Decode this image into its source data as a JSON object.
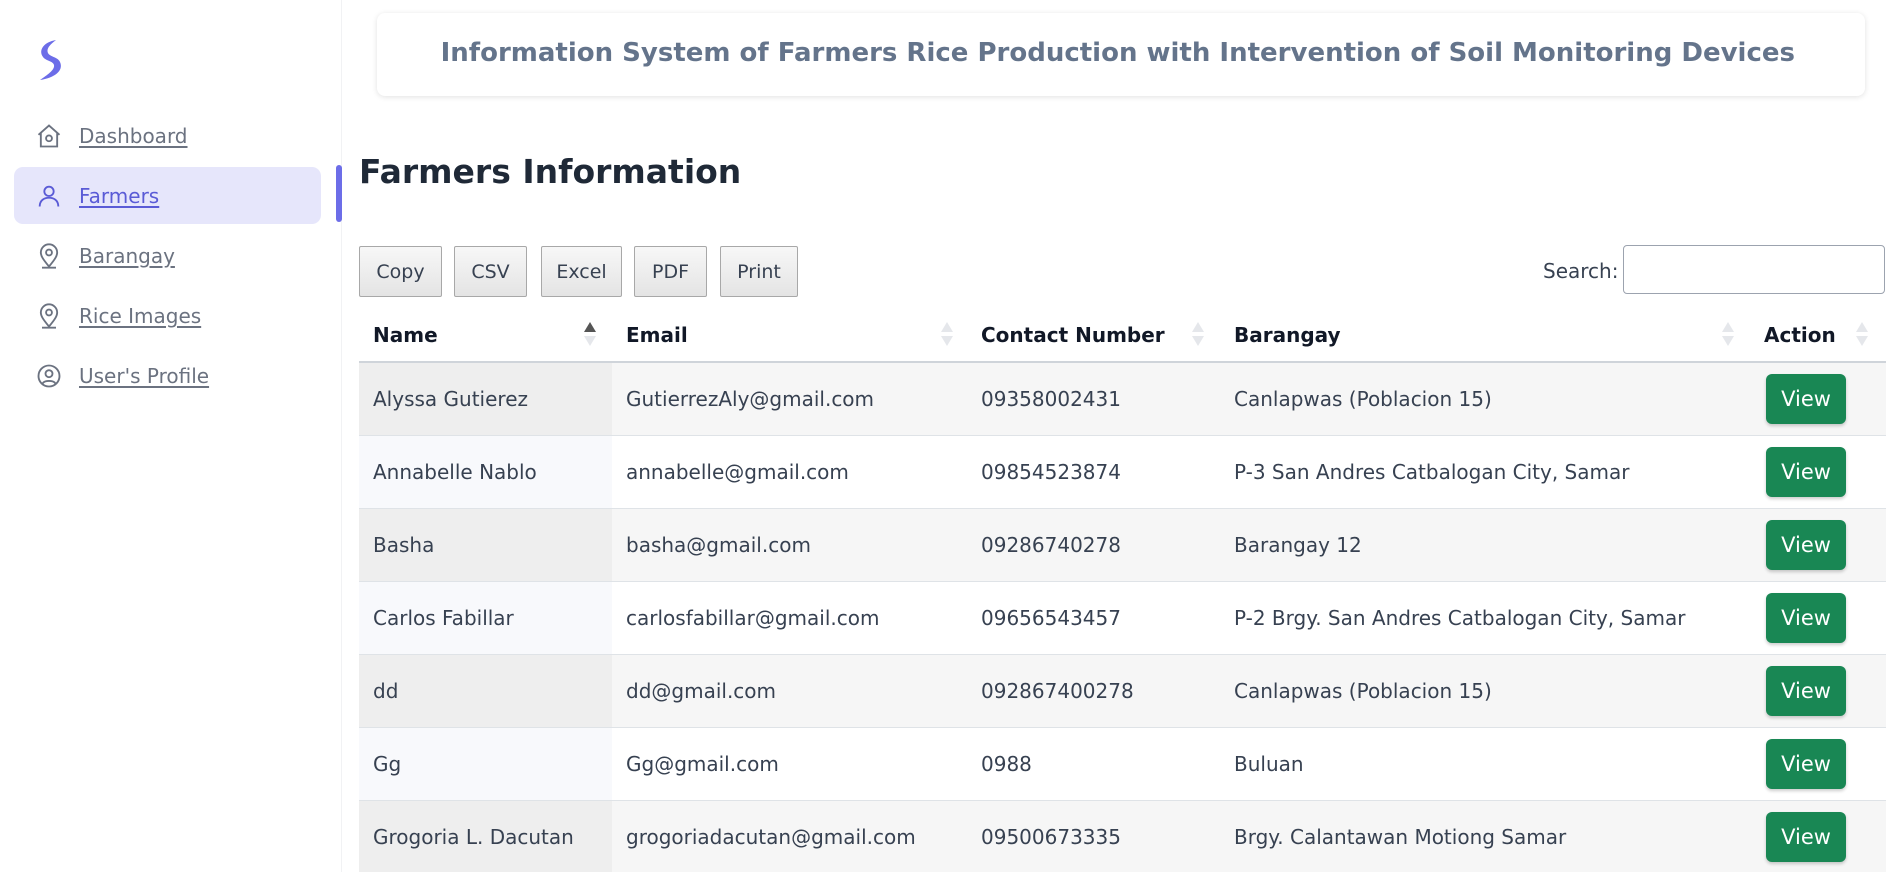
{
  "sidebar": {
    "items": [
      {
        "label": "Dashboard",
        "icon": "home-icon"
      },
      {
        "label": "Farmers",
        "icon": "user-icon",
        "active": true
      },
      {
        "label": "Barangay",
        "icon": "map-pin-icon"
      },
      {
        "label": "Rice Images",
        "icon": "map-pin-icon"
      },
      {
        "label": "User's Profile",
        "icon": "user-circle-icon"
      }
    ]
  },
  "header": {
    "title": "Information System of Farmers Rice Production with Intervention of Soil Monitoring Devices"
  },
  "page": {
    "title": "Farmers Information"
  },
  "toolbar": {
    "buttons": [
      "Copy",
      "CSV",
      "Excel",
      "PDF",
      "Print"
    ],
    "search_label": "Search:",
    "search_value": ""
  },
  "table": {
    "columns": [
      "Name",
      "Email",
      "Contact Number",
      "Barangay",
      "Action"
    ],
    "sorted_column": "Name",
    "sort_direction": "ascending",
    "rows": [
      {
        "name": "Alyssa Gutierez",
        "email": "GutierrezAly@gmail.com",
        "contact": "09358002431",
        "barangay": "Canlapwas (Poblacion 15)",
        "action": "View"
      },
      {
        "name": "Annabelle Nablo",
        "email": "annabelle@gmail.com",
        "contact": "09854523874",
        "barangay": "P-3 San Andres Catbalogan City, Samar",
        "action": "View"
      },
      {
        "name": "Basha",
        "email": "basha@gmail.com",
        "contact": "09286740278",
        "barangay": "Barangay 12",
        "action": "View"
      },
      {
        "name": "Carlos Fabillar",
        "email": "carlosfabillar@gmail.com",
        "contact": "09656543457",
        "barangay": "P-2 Brgy. San Andres Catbalogan City, Samar",
        "action": "View"
      },
      {
        "name": "dd",
        "email": "dd@gmail.com",
        "contact": "092867400278",
        "barangay": "Canlapwas (Poblacion 15)",
        "action": "View"
      },
      {
        "name": "Gg",
        "email": "Gg@gmail.com",
        "contact": "0988",
        "barangay": "Buluan",
        "action": "View"
      },
      {
        "name": "Grogoria L. Dacutan",
        "email": "grogoriadacutan@gmail.com",
        "contact": "09500673335",
        "barangay": "Brgy. Calantawan Motiong Samar",
        "action": "View"
      }
    ]
  },
  "colors": {
    "accent": "#6c6de8",
    "active_bg": "#e6e6fb",
    "view_button": "#198754",
    "header_text": "#64748b"
  }
}
